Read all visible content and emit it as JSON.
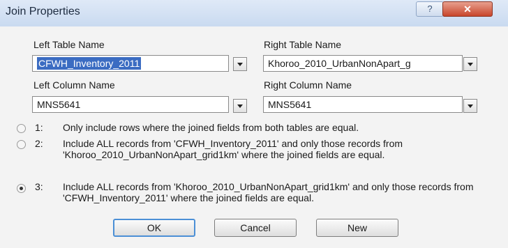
{
  "window": {
    "title": "Join Properties",
    "help_label": "?",
    "close_label": "✕"
  },
  "left_table": {
    "label": "Left Table Name",
    "value": "CFWH_Inventory_2011"
  },
  "right_table": {
    "label": "Right Table Name",
    "value": "Khoroo_2010_UrbanNonApart_g"
  },
  "left_column": {
    "label": "Left Column Name",
    "value": "MNS5641"
  },
  "right_column": {
    "label": "Right Column Name",
    "value": "MNS5641"
  },
  "options": [
    {
      "number": "1:",
      "text": "Only include rows where the joined fields from both tables are equal.",
      "selected": false
    },
    {
      "number": "2:",
      "text": "Include ALL records from 'CFWH_Inventory_2011' and only those records from 'Khoroo_2010_UrbanNonApart_grid1km' where the joined fields are equal.",
      "selected": false
    },
    {
      "number": "3:",
      "text": "Include ALL records from 'Khoroo_2010_UrbanNonApart_grid1km' and only those records from 'CFWH_Inventory_2011' where the joined fields are equal.",
      "selected": true
    }
  ],
  "buttons": {
    "ok": "OK",
    "cancel": "Cancel",
    "new": "New"
  }
}
